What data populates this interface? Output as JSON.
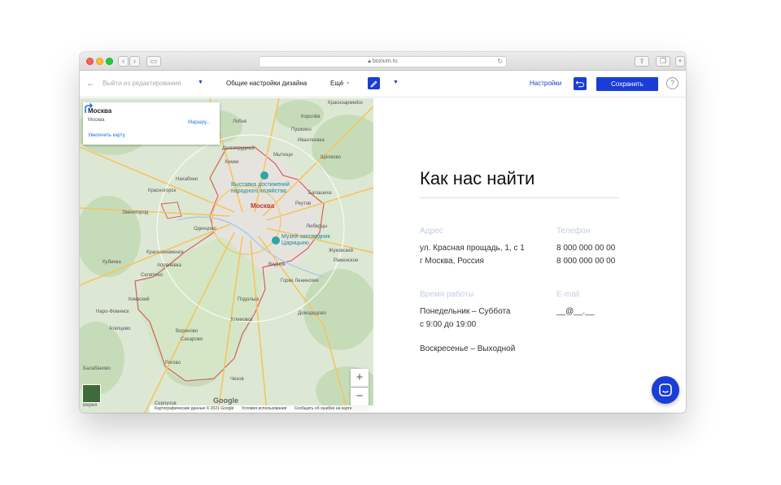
{
  "browser": {
    "url": "bozium.ru"
  },
  "toolbar": {
    "exit_label": "Выйти из редактирования",
    "design_settings_label": "Общие настройки дизайна",
    "more_label": "Ещё",
    "settings_label": "Настройки",
    "save_label": "Сохранить",
    "help_label": "?"
  },
  "map": {
    "card": {
      "title": "Москва",
      "subtitle": "Москва",
      "route_label": "Маршру...",
      "enlarge_label": "Увеличить карту"
    },
    "labels": {
      "moscow": "Москва",
      "poi_exhibition": "Выставка достижений",
      "poi_exhibition_2": "народного хозяйства",
      "poi_museum": "Музей-заповедник",
      "poi_museum_2": "Царицыно",
      "khimki": "Химки",
      "mytishchi": "Мытищи",
      "lobnya": "Лобня",
      "pushkino": "Пушкино",
      "ivanteevka": "Ивантеевка",
      "shchyolkovo": "Щёлково",
      "dolgoprudny": "Долгопрудный",
      "korolyov": "Королёв",
      "balashikha": "Балашиха",
      "reutov": "Реутов",
      "lyubertsy": "Люберцы",
      "odintsovo": "Одинцово",
      "krasnogorsk": "Красногорск",
      "zvenigorod": "Звенигород",
      "nakhabino": "Нахабино",
      "kubinka": "Кубинка",
      "selyatino": "Селятино",
      "aprelevka": "Апрелевка",
      "naro_fominsk": "Наро-Фоминск",
      "kievsky": "Киевский",
      "podolsk": "Подольск",
      "klimovsk": "Климовск",
      "vidnoye": "Видное",
      "gorki_leninskie": "Горки Ленинские",
      "zhukovsky": "Жуковский",
      "ramenskoye": "Раменское",
      "domodedovo": "Домодедово",
      "chekhov": "Чехов",
      "voronovo": "Вороново",
      "rogovo": "Рогово",
      "sakharovo": "Сахарово",
      "serpukhov": "Серпухов",
      "atepcevo": "Атепцево",
      "krasnoarmeysk": "Красноармейск",
      "krasnoznamensk": "Краснознаменск",
      "balabanovo": "Балабаново",
      "vereya": "Верея"
    },
    "zoom_in": "+",
    "zoom_out": "−",
    "google": "Google",
    "footer": {
      "data": "Картографические данные © 2021 Google",
      "terms": "Условия использования",
      "report": "Сообщить об ошибке на карте"
    }
  },
  "contacts": {
    "title": "Как нас найти",
    "address_label": "Адрес",
    "address_line1": "ул. Красная прощадь, 1, с 1",
    "address_line2": "г Москва, Россия",
    "phone_label": "Телефон",
    "phone_1": "8 000 000 00 00",
    "phone_2": "8 000 000 00 00",
    "hours_label": "Время работы",
    "hours_line1": "Понедельник – Суббота",
    "hours_line2": "с 9:00 до 19:00",
    "hours_line3": "Воскресенье – Выходной",
    "email_label": "E-mail",
    "email_value": "__@__.__"
  }
}
